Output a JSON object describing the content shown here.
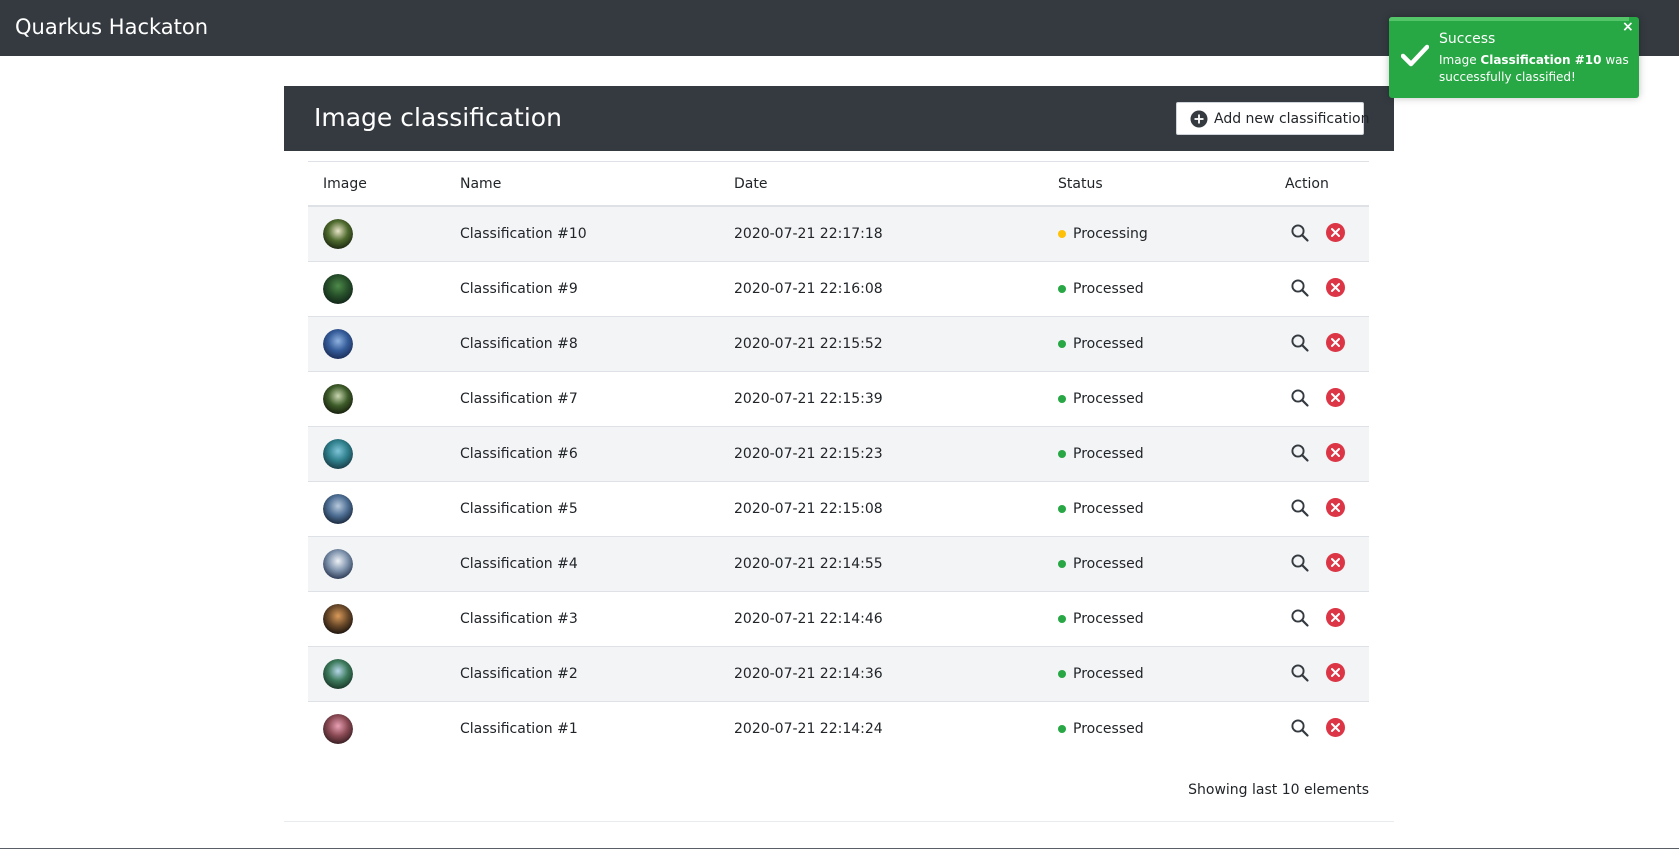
{
  "navbar": {
    "brand": "Quarkus Hackaton"
  },
  "card": {
    "title": "Image classification",
    "add_button_label": "Add new classification",
    "add_icon": "plus-circle-icon"
  },
  "table": {
    "headers": [
      "Image",
      "Name",
      "Date",
      "Status",
      "Action"
    ],
    "rows": [
      {
        "name": "Classification #10",
        "date": "2020-07-21 22:17:18",
        "status": "Processing",
        "status_color": "#ffc107"
      },
      {
        "name": "Classification #9",
        "date": "2020-07-21 22:16:08",
        "status": "Processed",
        "status_color": "#28a745"
      },
      {
        "name": "Classification #8",
        "date": "2020-07-21 22:15:52",
        "status": "Processed",
        "status_color": "#28a745"
      },
      {
        "name": "Classification #7",
        "date": "2020-07-21 22:15:39",
        "status": "Processed",
        "status_color": "#28a745"
      },
      {
        "name": "Classification #6",
        "date": "2020-07-21 22:15:23",
        "status": "Processed",
        "status_color": "#28a745"
      },
      {
        "name": "Classification #5",
        "date": "2020-07-21 22:15:08",
        "status": "Processed",
        "status_color": "#28a745"
      },
      {
        "name": "Classification #4",
        "date": "2020-07-21 22:14:55",
        "status": "Processed",
        "status_color": "#28a745"
      },
      {
        "name": "Classification #3",
        "date": "2020-07-21 22:14:46",
        "status": "Processed",
        "status_color": "#28a745"
      },
      {
        "name": "Classification #2",
        "date": "2020-07-21 22:14:36",
        "status": "Processed",
        "status_color": "#28a745"
      },
      {
        "name": "Classification #1",
        "date": "2020-07-21 22:14:24",
        "status": "Processed",
        "status_color": "#28a745"
      }
    ],
    "row_action_icons": [
      "search-icon",
      "delete-icon"
    ],
    "footer": "Showing last 10 elements"
  },
  "toast": {
    "title": "Success",
    "message_prefix": "Image ",
    "message_bold": "Classification #10",
    "message_suffix": " was successfully classified!",
    "close_label": "×",
    "color": "#28a745"
  },
  "colors": {
    "dark": "#343a40",
    "success": "#28a745",
    "warning": "#ffc107",
    "danger": "#dc3545"
  }
}
